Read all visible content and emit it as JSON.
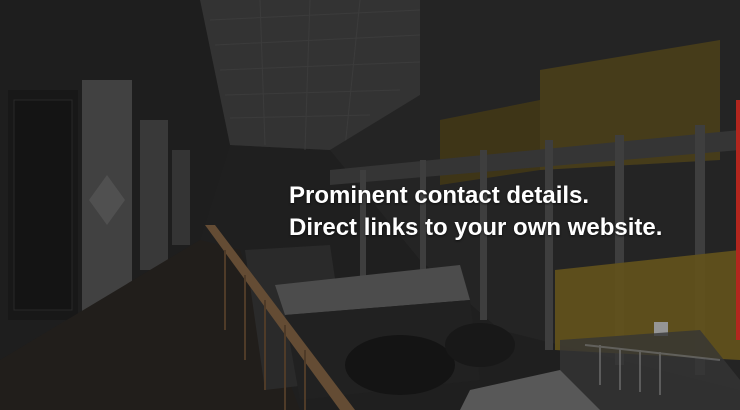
{
  "slide": {
    "line1": "Prominent contact details.",
    "line2": "Direct links to your own website."
  },
  "colors": {
    "caption_text": "#ffffff",
    "accent_edge": "#b3261e",
    "wall_yellow": "#8a7326"
  },
  "background": {
    "kind": "photo",
    "subject": "museum-gallery-interior"
  }
}
